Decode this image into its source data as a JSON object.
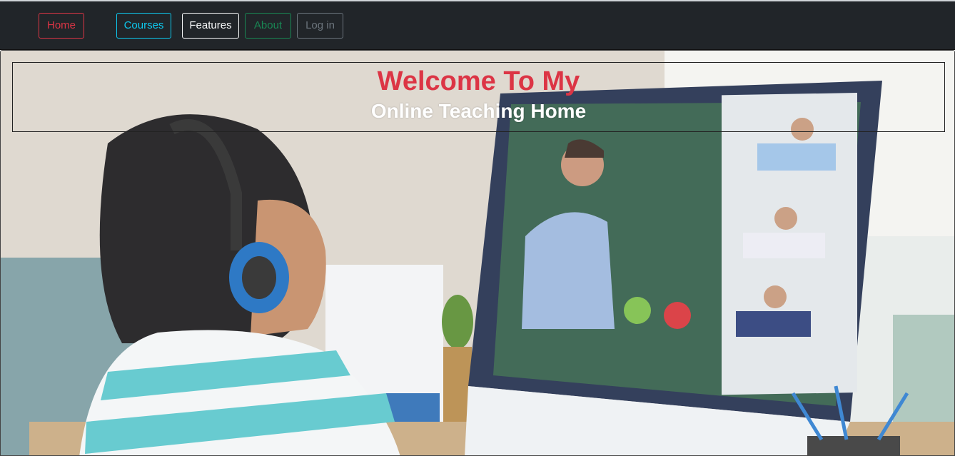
{
  "nav": {
    "home": "Home",
    "courses": "Courses",
    "features": "Features",
    "about": "About",
    "login": "Log in"
  },
  "hero": {
    "title": "Welcome To My",
    "subtitle": "Online Teaching Home",
    "image_icon": "student-video-call-photo"
  },
  "colors": {
    "navbar_bg": "#212529",
    "home": "#dc3545",
    "courses": "#0dcaf0",
    "features": "#f8f9fa",
    "about": "#198754",
    "login": "#6c757d",
    "title": "#dc3545",
    "subtitle": "#ffffff"
  }
}
